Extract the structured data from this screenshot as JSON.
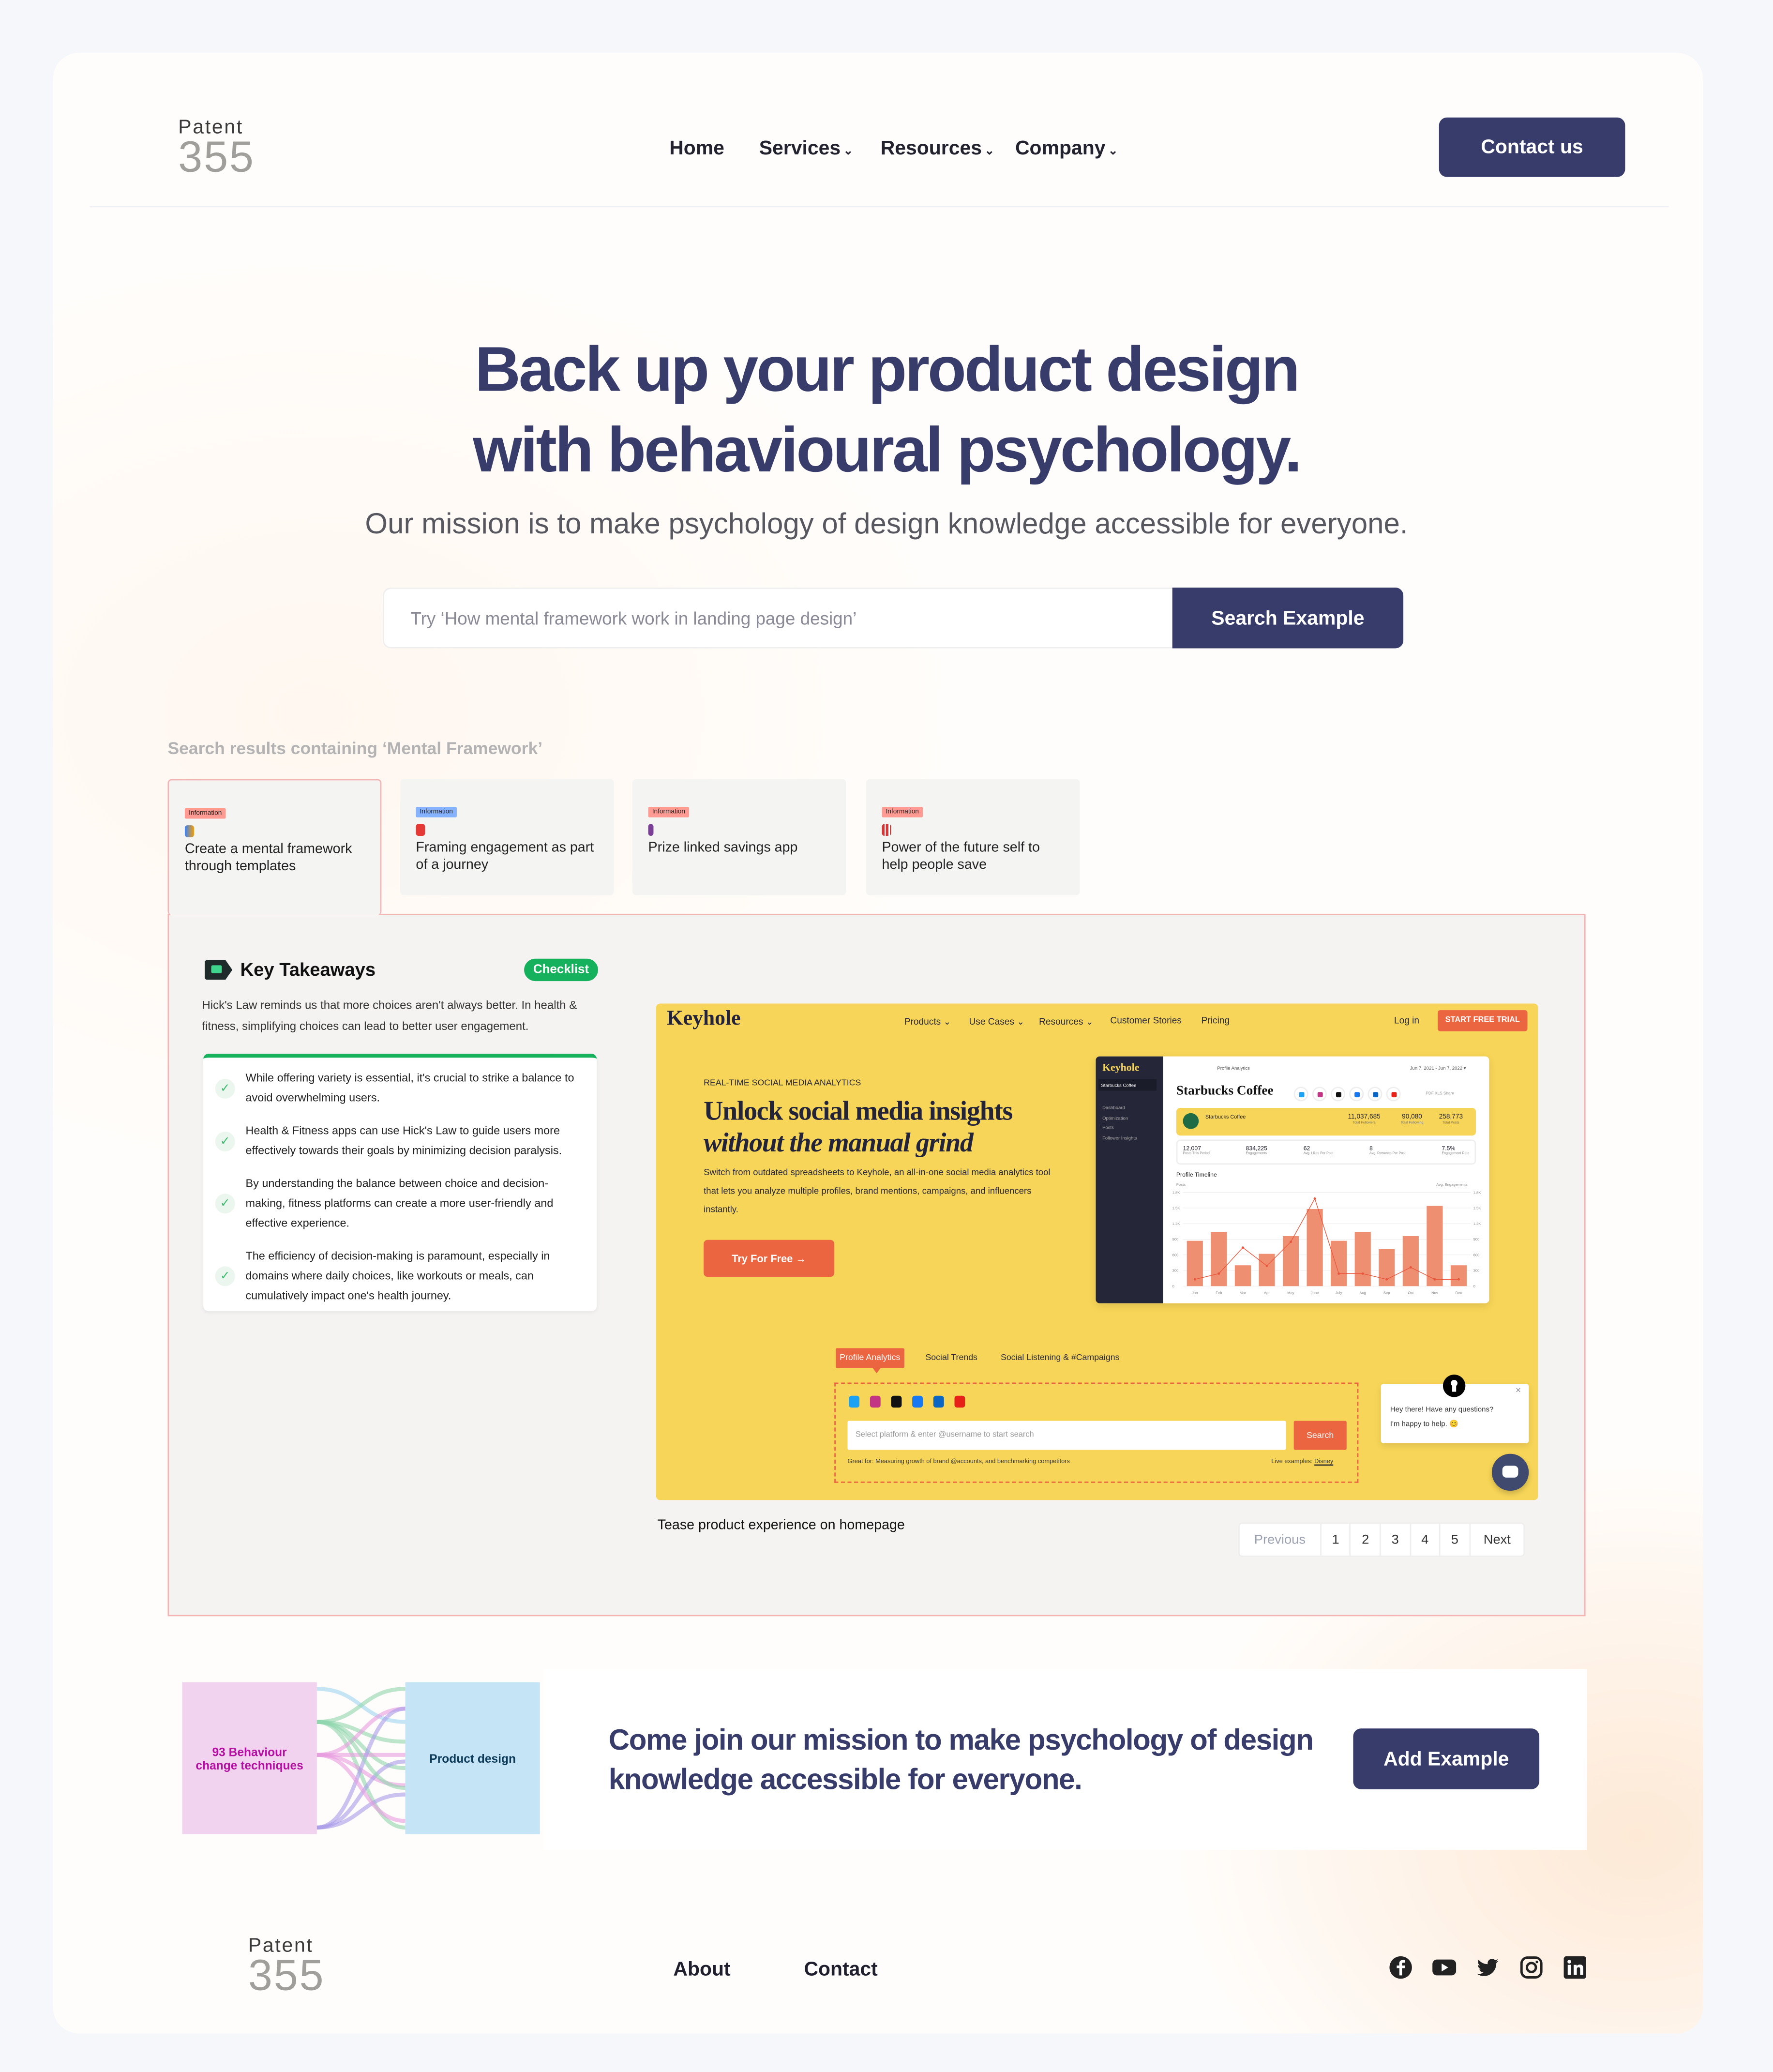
{
  "header": {
    "logo_top": "Patent",
    "logo_num": "355",
    "nav": [
      {
        "label": "Home"
      },
      {
        "label": "Services",
        "dropdown": true
      },
      {
        "label": "Resources",
        "dropdown": true
      },
      {
        "label": "Company",
        "dropdown": true
      }
    ],
    "contact_label": "Contact us"
  },
  "hero": {
    "title_line1": "Back up your product design",
    "title_line2": "with behavioural psychology.",
    "subtitle": "Our mission is to make psychology of design knowledge accessible for everyone.",
    "search_placeholder": "Try ‘How mental framework work in landing page design’",
    "search_button": "Search Example"
  },
  "results": {
    "heading": "Search results containing ‘Mental Framework’",
    "cards": [
      {
        "badge": "Information",
        "badge_color": "#ff9b93",
        "title": "Create a mental framework through templates",
        "active": true
      },
      {
        "badge": "Information",
        "badge_color": "#86b3ff",
        "title": "Framing engagement as part of a journey"
      },
      {
        "badge": "Information",
        "badge_color": "#ff9b93",
        "title": "Prize linked savings app"
      },
      {
        "badge": "Information",
        "badge_color": "#ff9b93",
        "title": "Power of the future self to help people save"
      }
    ]
  },
  "takeaways": {
    "title": "Key Takeaways",
    "badge": "Checklist",
    "intro": "Hick's Law reminds us that more choices aren't always better. In health & fitness, simplifying choices can lead to better user engagement.",
    "items": [
      "While offering variety is essential, it's crucial to strike a balance to avoid overwhelming users.",
      "Health & Fitness apps can use Hick's Law to guide users more effectively towards their goals by minimizing decision paralysis.",
      "By understanding the balance between choice and decision-making, fitness platforms can create a more user-friendly and effective experience.",
      "The efficiency of decision-making is paramount, especially in domains where daily choices, like workouts or meals, can cumulatively impact one's health journey."
    ]
  },
  "example": {
    "logo": "Keyhole",
    "nav": [
      "Products ⌄",
      "Use Cases ⌄",
      "Resources ⌄",
      "Customer Stories",
      "Pricing"
    ],
    "login": "Log in",
    "trial": "START FREE TRIAL",
    "eyebrow": "REAL-TIME SOCIAL MEDIA ANALYTICS",
    "headline1": "Unlock social media insights",
    "headline2": "without the manual grind",
    "body": "Switch from outdated spreadsheets to Keyhole, an all-in-one social media analytics tool that lets you analyze multiple profiles, brand mentions, campaigns, and influencers instantly.",
    "cta": "Try For Free →",
    "dash": {
      "logo": "Keyhole",
      "side": [
        "Starbucks Coffee",
        "Dashboard",
        "Optimization",
        "Posts",
        "Follower Insights"
      ],
      "crumb": "Profile Analytics",
      "date": "Jun 7, 2021 - Jun 7, 2022 ▾",
      "brand": "Starbucks Coffee",
      "exports": "PDF  XLS  Share",
      "stats": [
        {
          "v": "11,037,685",
          "l": "Total Followers"
        },
        {
          "v": "90,080",
          "l": "Total Following"
        },
        {
          "v": "258,773",
          "l": "Total Posts"
        }
      ],
      "kpis": [
        {
          "v": "12,007",
          "l": "Posts This Period"
        },
        {
          "v": "834,225",
          "l": "Engagements"
        },
        {
          "v": "62",
          "l": "Avg. Likes Per Post"
        },
        {
          "v": "8",
          "l": "Avg. Retweets Per Post"
        },
        {
          "v": "7.5%",
          "l": "Engagement Rate"
        }
      ],
      "timeline": {
        "title": "Profile Timeline",
        "left_label": "Posts",
        "right_label": "Avg. Engagements",
        "ticks": [
          "1.8K",
          "1.5K",
          "1.2K",
          "900",
          "600",
          "300",
          "0"
        ],
        "months": [
          "Jan",
          "Feb",
          "Mar",
          "Apr",
          "May",
          "June",
          "July",
          "Aug",
          "Sep",
          "Oct",
          "Nov",
          "Dec"
        ],
        "bars": [
          870,
          1040,
          400,
          620,
          960,
          1480,
          870,
          1040,
          710,
          960,
          1540,
          400
        ],
        "line": [
          130,
          240,
          740,
          390,
          850,
          1680,
          240,
          240,
          130,
          360,
          130,
          130
        ],
        "bar_color": "#ef8f72"
      }
    },
    "tabs": [
      "Profile Analytics",
      "Social Trends",
      "Social Listening & #Campaigns"
    ],
    "search_placeholder": "Select platform & enter @username to start search",
    "search_btn": "Search",
    "great_for": "Great for: Measuring growth of brand @accounts, and benchmarking competitors",
    "live_label": "Live examples:",
    "live_link": "Disney",
    "chat_line1": "Hey there! Have any questions?",
    "chat_line2": "I'm happy to help. 😊",
    "caption": "Tease product experience on homepage"
  },
  "pagination": {
    "prev": "Previous",
    "pages": [
      "1",
      "2",
      "3",
      "4",
      "5"
    ],
    "next": "Next"
  },
  "cta": {
    "left_node": "93 Behaviour change techniques",
    "right_node": "Product design",
    "text": "Come join our mission to make psychology of design knowledge accessible for everyone.",
    "button": "Add Example"
  },
  "footer": {
    "logo_top": "Patent",
    "logo_num": "355",
    "links": [
      "About",
      "Contact"
    ],
    "social": [
      "facebook",
      "youtube",
      "twitter",
      "instagram",
      "linkedin"
    ]
  },
  "colors": {
    "primary": "#373c6b",
    "keyhole_yellow": "#f7d558",
    "keyhole_orange": "#ec6541",
    "check_green": "#15b15c"
  }
}
